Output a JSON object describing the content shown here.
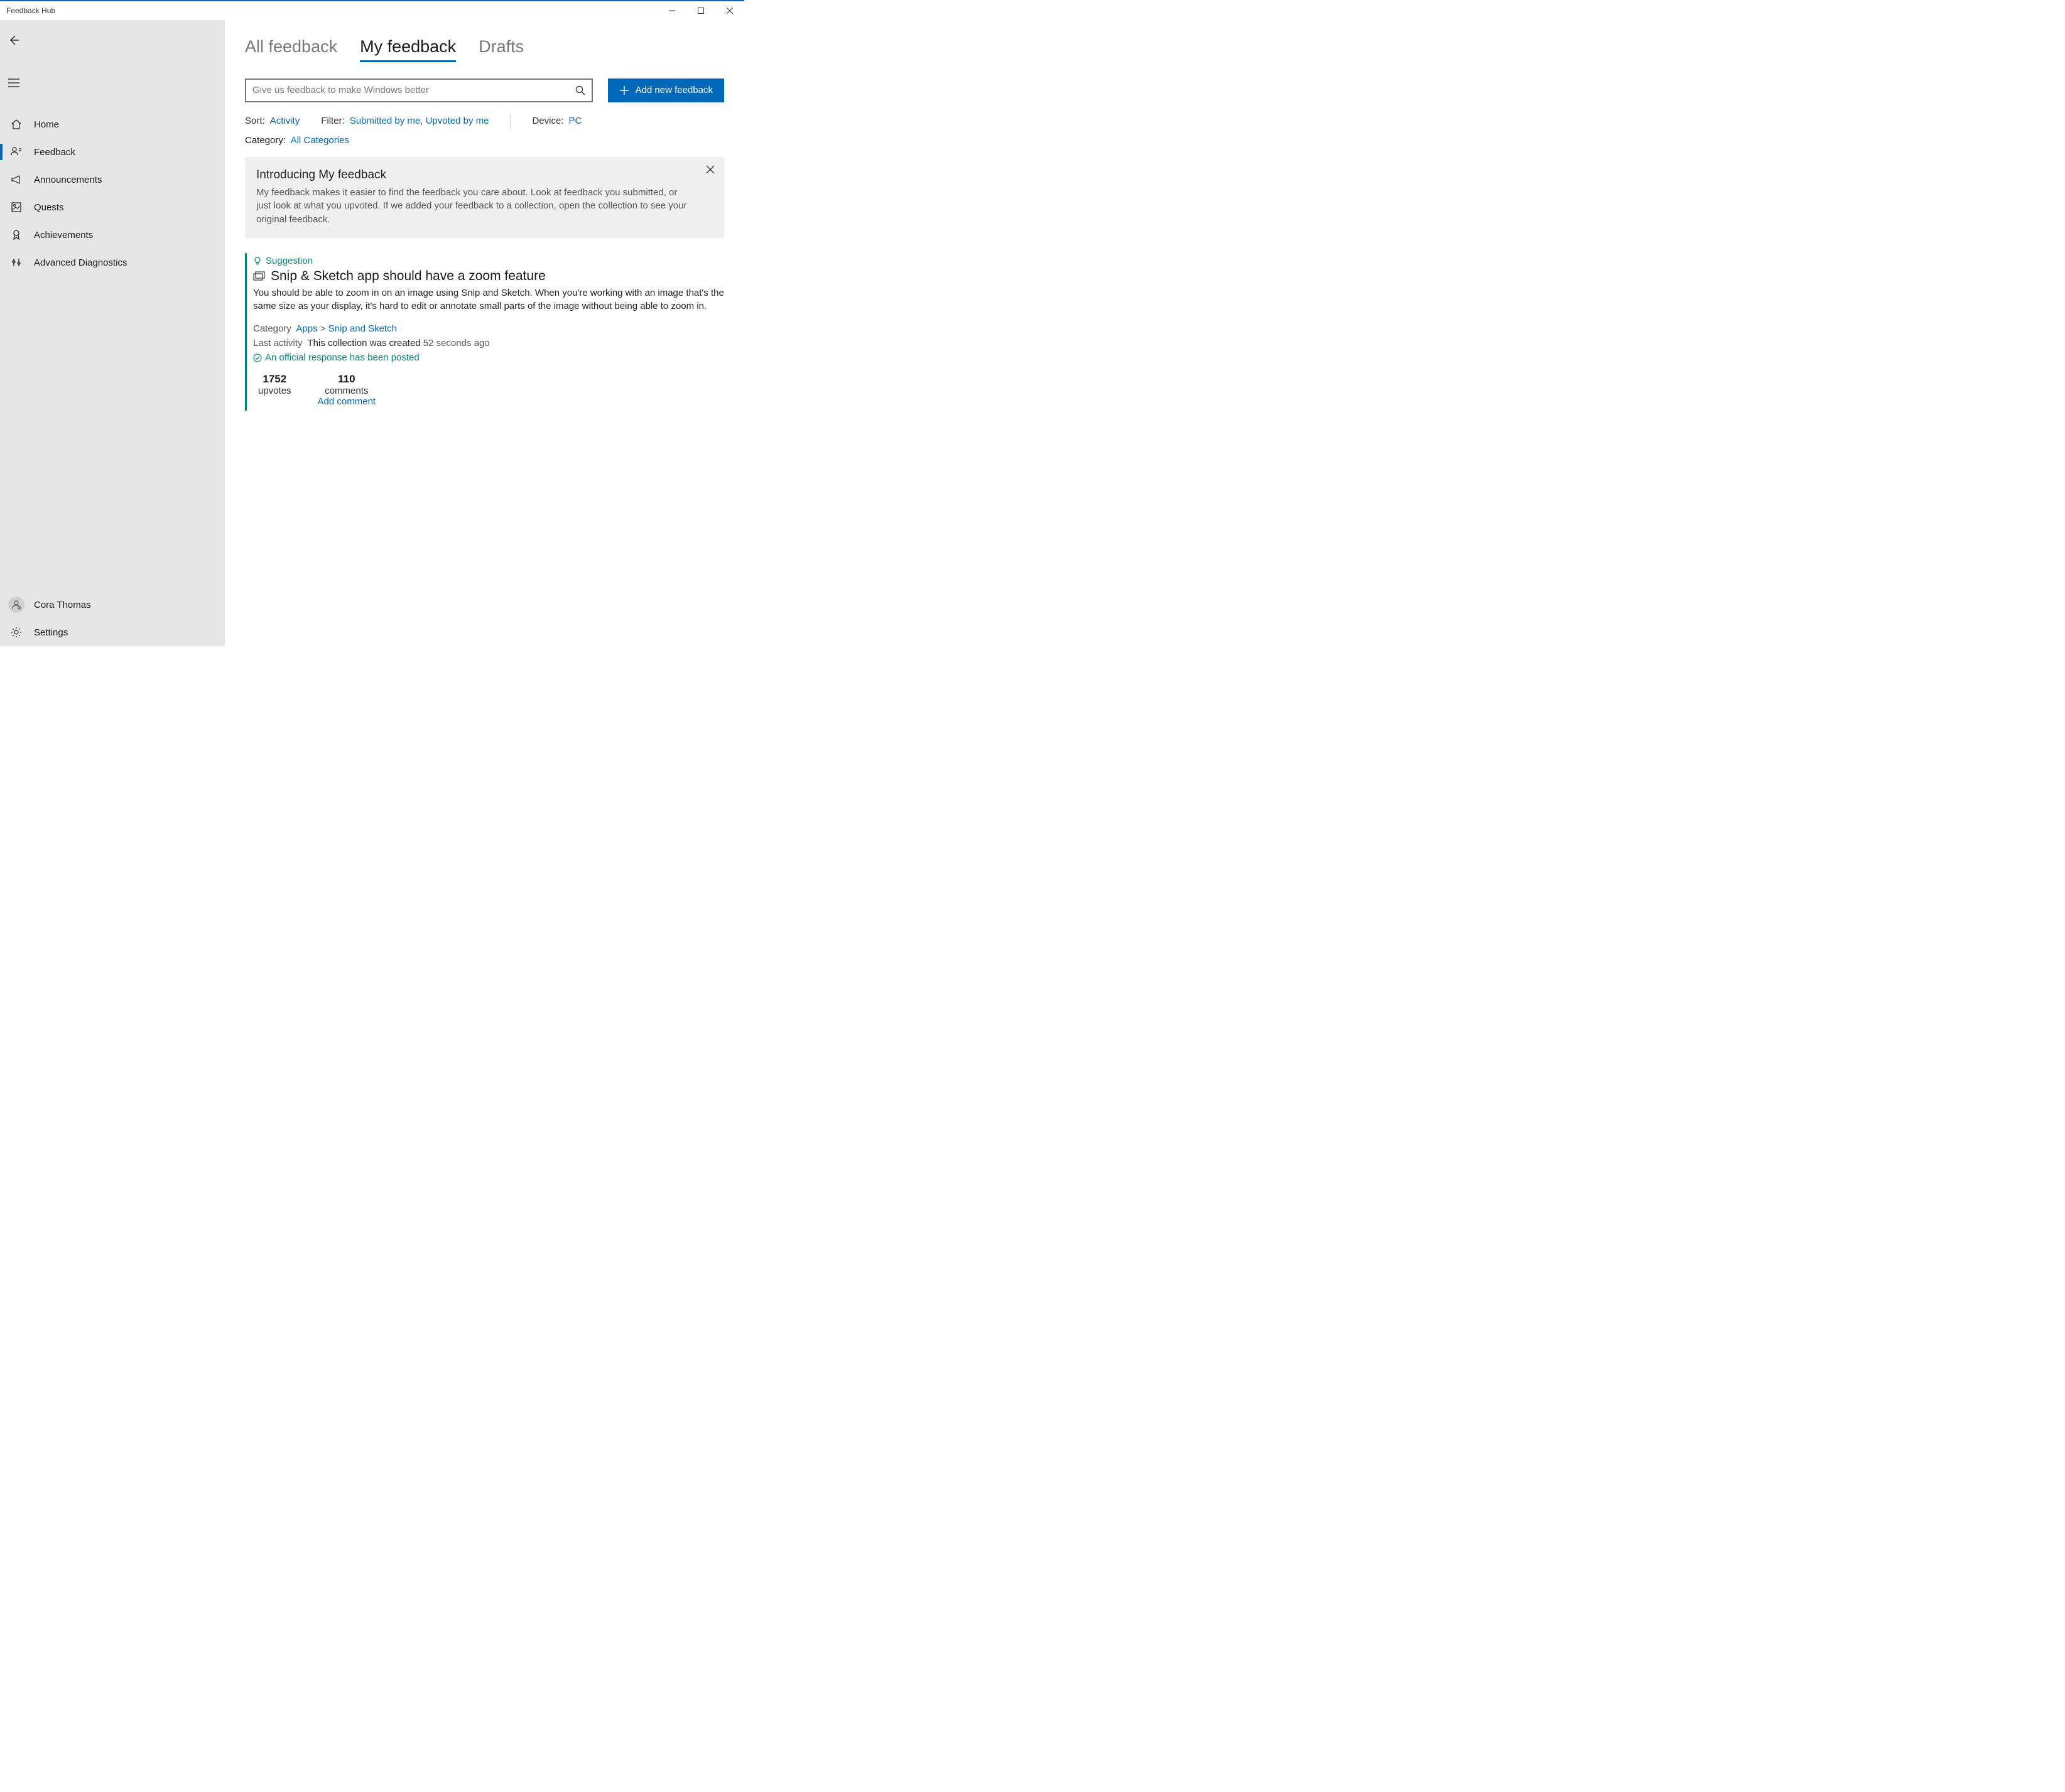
{
  "window": {
    "title": "Feedback Hub"
  },
  "sidebar": {
    "nav": [
      {
        "label": "Home"
      },
      {
        "label": "Feedback"
      },
      {
        "label": "Announcements"
      },
      {
        "label": "Quests"
      },
      {
        "label": "Achievements"
      },
      {
        "label": "Advanced Diagnostics"
      }
    ],
    "user": "Cora Thomas",
    "settings": "Settings"
  },
  "tabs": {
    "all": "All feedback",
    "mine": "My feedback",
    "drafts": "Drafts"
  },
  "search": {
    "placeholder": "Give us feedback to make Windows better"
  },
  "add_button": "Add new feedback",
  "filters": {
    "sort_label": "Sort:",
    "sort_value": "Activity",
    "filter_label": "Filter:",
    "filter_value": "Submitted by me, Upvoted by me",
    "device_label": "Device:",
    "device_value": "PC",
    "category_label": "Category:",
    "category_value": "All Categories"
  },
  "infobox": {
    "title": "Introducing My feedback",
    "body": "My feedback makes it easier to find the feedback you care about. Look at feedback you submitted, or just look at what you upvoted. If we added your feedback to a collection, open the collection to see your original feedback."
  },
  "card": {
    "tag": "Suggestion",
    "title": "Snip & Sketch app should have a zoom feature",
    "desc": "You should be able to zoom in on an image using Snip and Sketch. When you're working with an image that's the same size as your display, it's hard to edit or annotate small parts of the image without being able to zoom in.",
    "category_label": "Category",
    "category_l1": "Apps",
    "category_sep": ">",
    "category_l2": "Snip and Sketch",
    "activity_label": "Last activity",
    "activity_text": "This collection was created",
    "activity_time": "52 seconds ago",
    "official": "An official response has been posted",
    "upvotes_num": "1752",
    "upvotes_lbl": "upvotes",
    "comments_num": "110",
    "comments_lbl": "comments",
    "add_comment": "Add comment"
  }
}
